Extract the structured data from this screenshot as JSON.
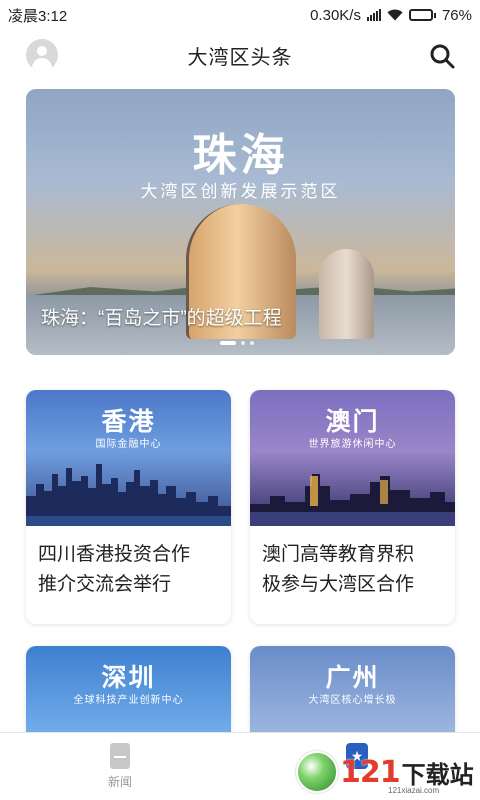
{
  "status_bar": {
    "time": "凌晨3:12",
    "network_speed": "0.30K/s",
    "battery": "76%",
    "battery_level": 0.76
  },
  "header": {
    "title": "大湾区头条"
  },
  "banner": {
    "title": "珠海",
    "subtitle": "大湾区创新发展示范区",
    "caption": "珠海：“百岛之市”的超级工程",
    "pages": 3,
    "active_page": 1
  },
  "cards": [
    {
      "city": "香港",
      "tag": "国际金融中心",
      "headline_line1": "四川香港投资合作",
      "headline_line2": "推介交流会举行"
    },
    {
      "city": "澳门",
      "tag": "世界旅游休闲中心",
      "headline_line1": "澳门高等教育界积",
      "headline_line2": "极参与大湾区合作"
    },
    {
      "city": "深圳",
      "tag": "全球科技产业创新中心"
    },
    {
      "city": "广州",
      "tag": "大湾区核心增长极"
    }
  ],
  "bottom_nav": {
    "news_label": "新闻"
  },
  "watermark": {
    "number": "121",
    "text": "下载站",
    "url": "121xiazai.com"
  },
  "icons": {
    "header_left": "avatar-icon",
    "header_right": "search-icon",
    "nav_news": "news-icon"
  }
}
